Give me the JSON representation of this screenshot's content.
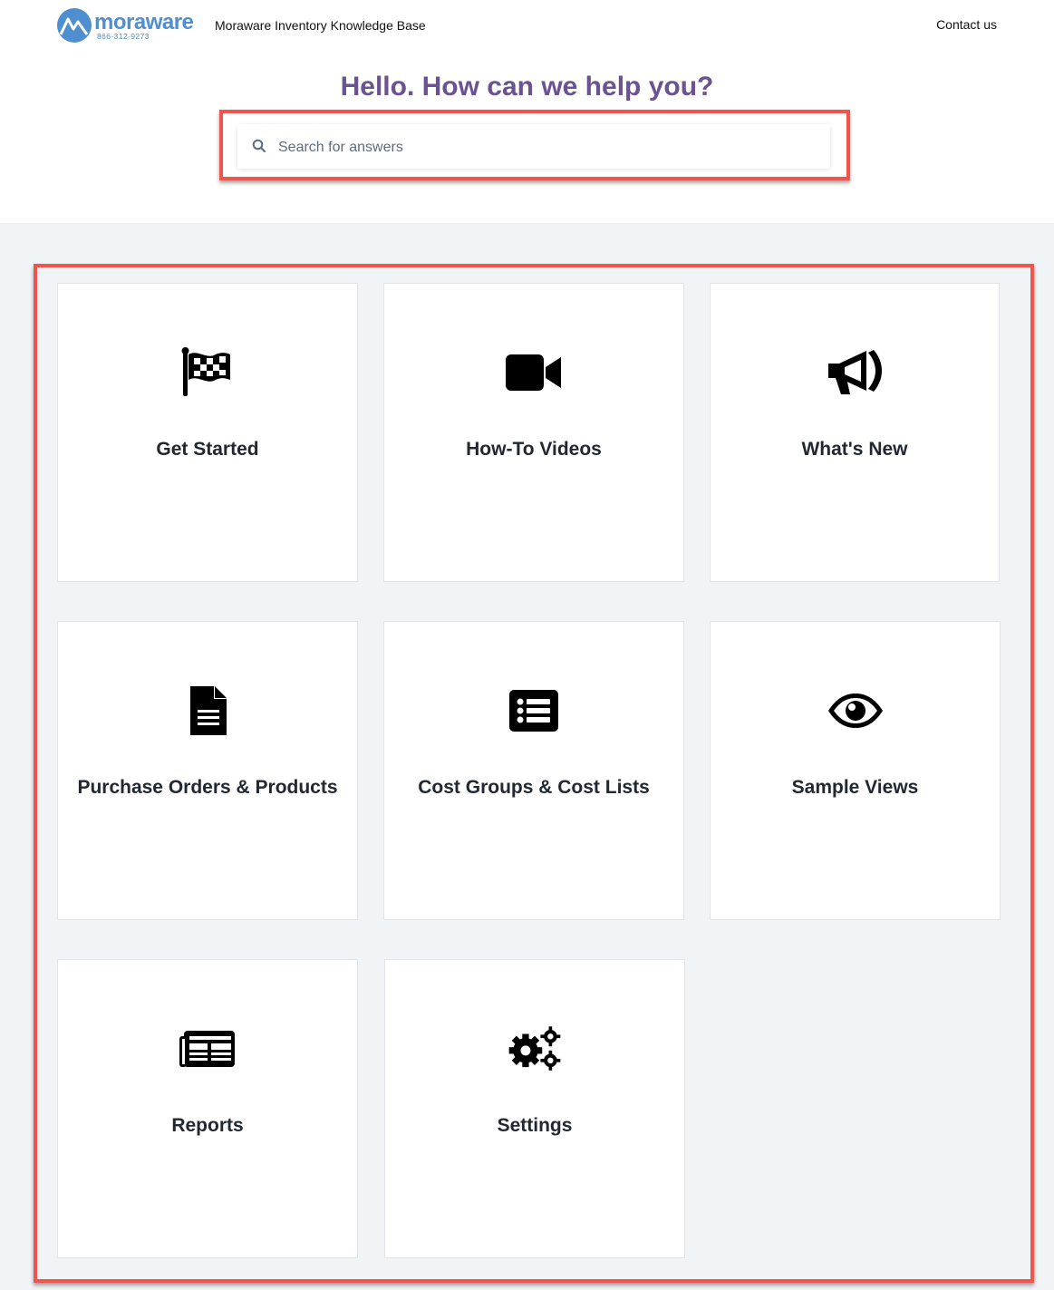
{
  "header": {
    "logo_text": "moraware",
    "logo_phone": "866-312-9273",
    "site_title": "Moraware Inventory Knowledge Base",
    "contact_label": "Contact us"
  },
  "hero": {
    "headline": "Hello. How can we help you?",
    "search_placeholder": "Search for answers"
  },
  "categories": [
    {
      "label": "Get Started",
      "icon": "checkered-flag-icon"
    },
    {
      "label": "How-To Videos",
      "icon": "video-camera-icon"
    },
    {
      "label": "What's New",
      "icon": "megaphone-icon"
    },
    {
      "label": "Purchase Orders & Products",
      "icon": "document-icon"
    },
    {
      "label": "Cost Groups & Cost Lists",
      "icon": "list-icon"
    },
    {
      "label": "Sample Views",
      "icon": "eye-icon"
    },
    {
      "label": "Reports",
      "icon": "newspaper-icon"
    },
    {
      "label": "Settings",
      "icon": "gears-icon"
    }
  ],
  "colors": {
    "brand_blue": "#4f8fcf",
    "headline_purple": "#6b5290",
    "highlight_red": "#f0544c",
    "main_background": "#f0f4f7"
  }
}
